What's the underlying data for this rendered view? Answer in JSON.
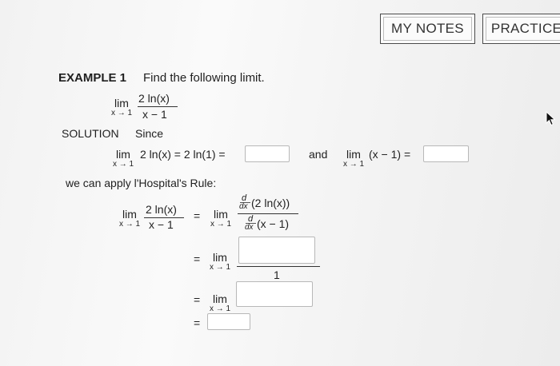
{
  "header": {
    "notes_label": "MY NOTES",
    "practice_label": "PRACTICE"
  },
  "example": {
    "label": "EXAMPLE 1",
    "instruction": "Find the following limit.",
    "lim": "lim",
    "approach": "x → 1",
    "numerator": "2 ln(x)",
    "denominator": "x − 1"
  },
  "solution": {
    "label": "SOLUTION",
    "since": "Since",
    "expr1": "2 ln(x) = 2 ln(1) =",
    "and": "and",
    "expr2": "(x − 1) =",
    "apply_text": "we can apply l'Hospital's Rule:",
    "eq": "=",
    "d": "d",
    "dx": "dx",
    "deriv_num": "(2 ln(x))",
    "deriv_den": "(x − 1)",
    "one": "1"
  }
}
